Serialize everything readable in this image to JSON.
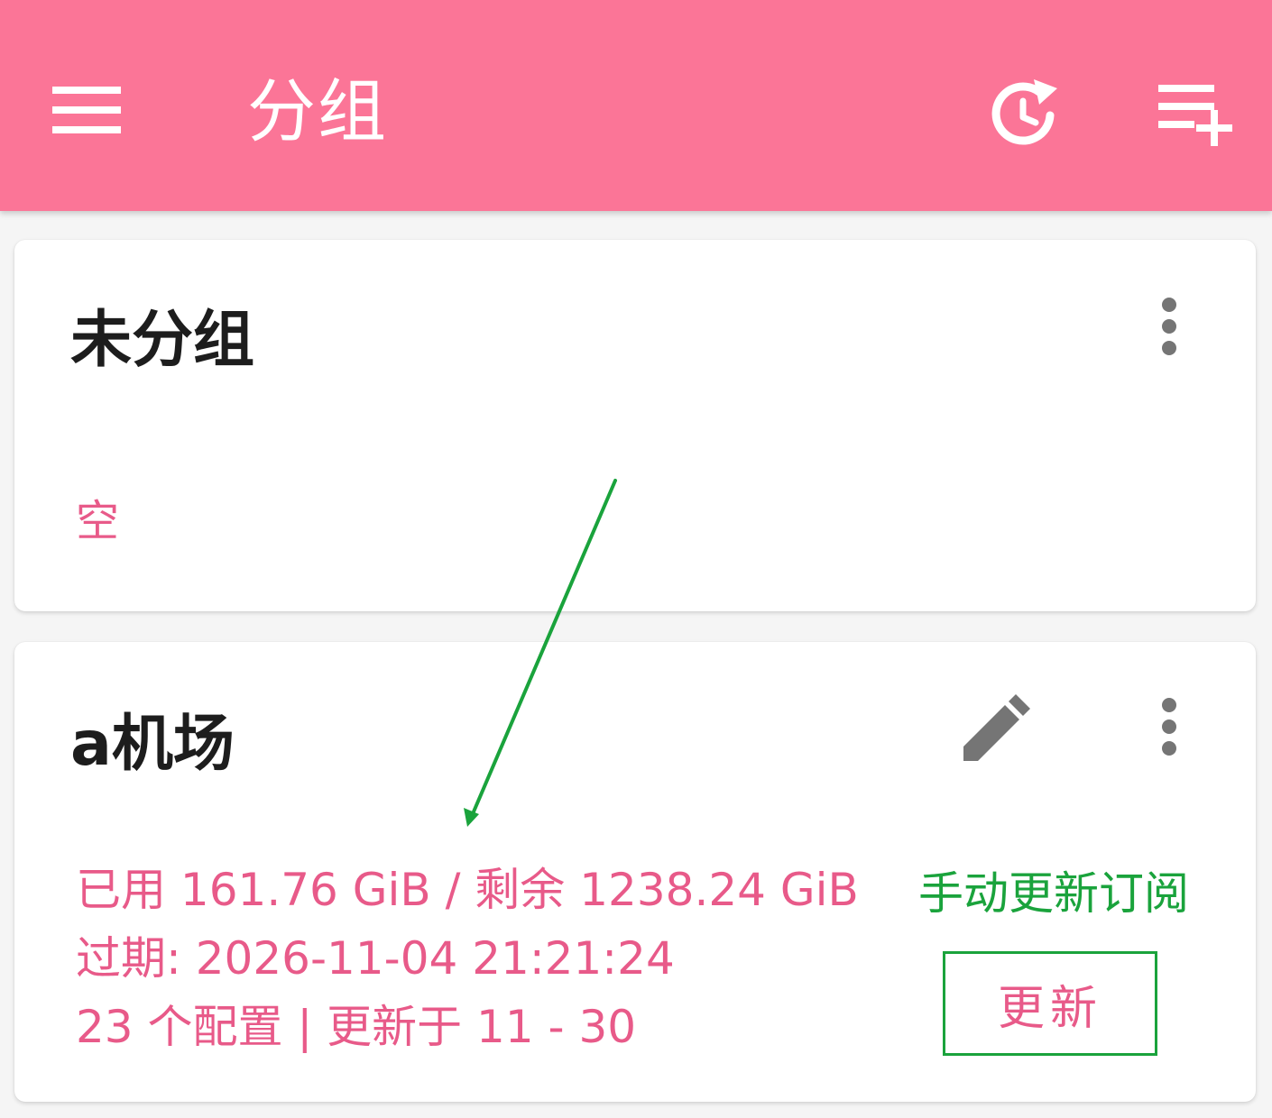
{
  "theme": {
    "primary": "#fb7597",
    "accent_text": "#e85a89",
    "annotation": "#1aa33c"
  },
  "appbar": {
    "title": "分组",
    "icons": [
      "menu-icon",
      "history-icon",
      "playlist-add-icon"
    ]
  },
  "groups": [
    {
      "title": "未分组",
      "status": "空"
    },
    {
      "title": "a机场",
      "usage": "已用 161.76 GiB / 剩余 1238.24 GiB",
      "expiry": "过期: 2026-11-04 21:21:24",
      "summary": "23 个配置 | 更新于 11 - 30",
      "update_button": "更新"
    }
  ],
  "annotation": {
    "label": "手动更新订阅"
  }
}
